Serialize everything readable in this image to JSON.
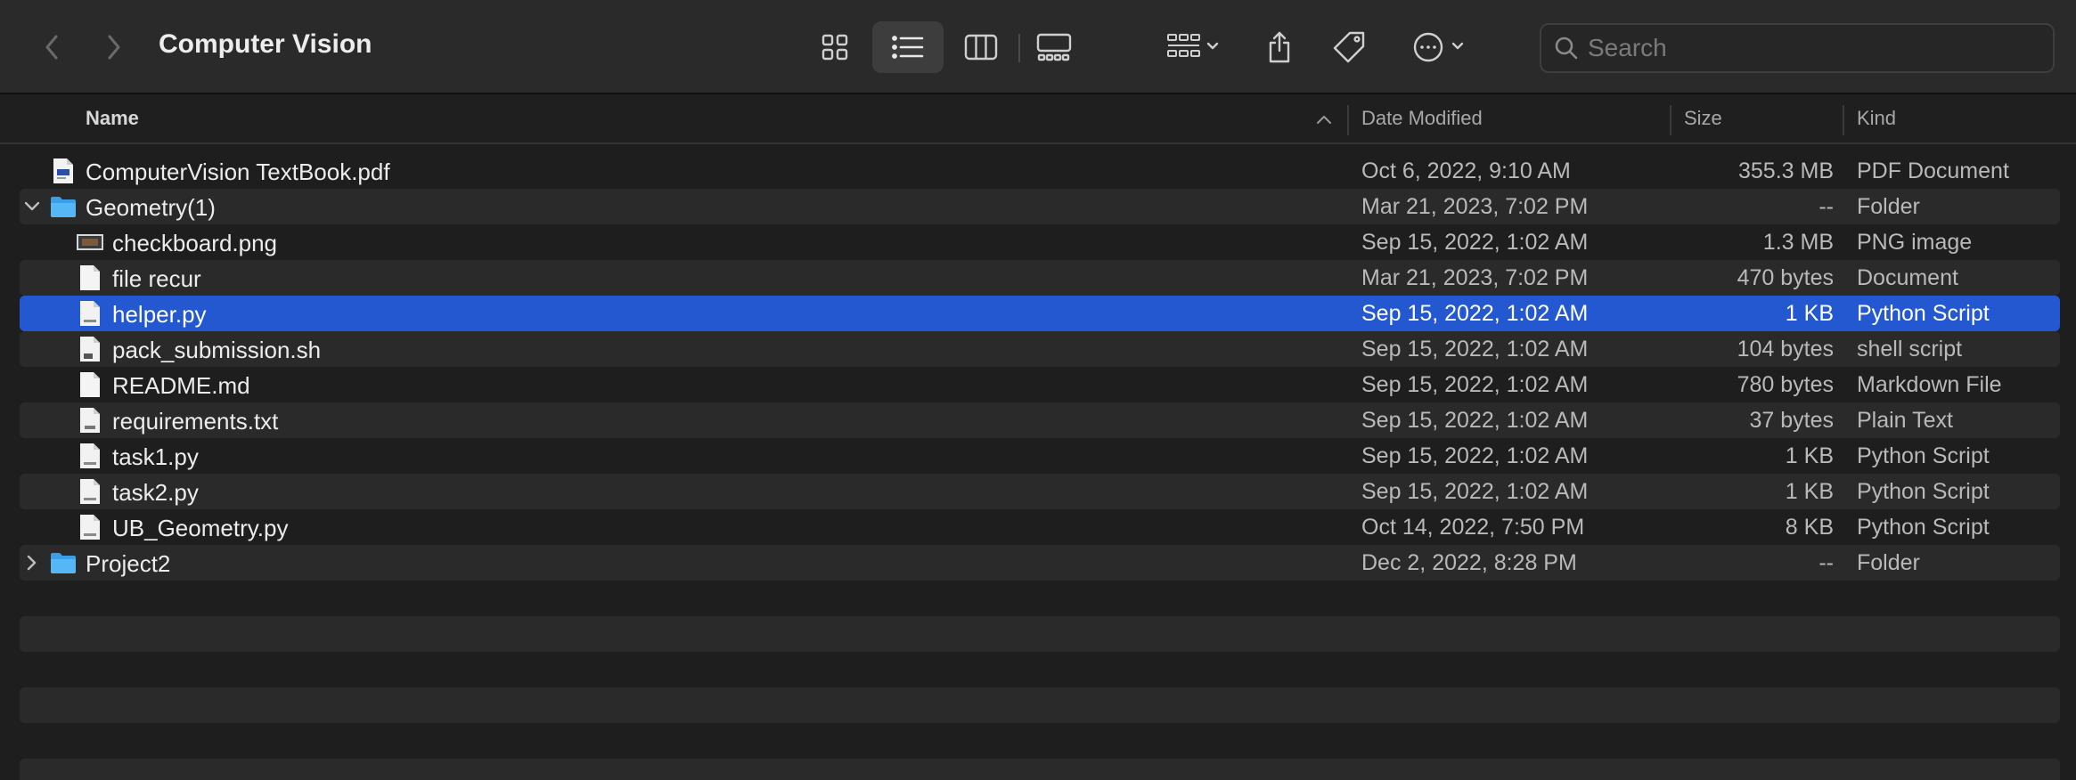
{
  "window": {
    "title": "Computer Vision"
  },
  "toolbar": {
    "back_icon": "chevron-left-icon",
    "forward_icon": "chevron-right-icon",
    "views": [
      "icon-view-icon",
      "list-view-icon",
      "column-view-icon",
      "gallery-view-icon"
    ],
    "active_view": "list",
    "group_icon": "group-by-icon",
    "share_icon": "share-icon",
    "tag_icon": "tag-icon",
    "more_icon": "ellipsis-circle-icon"
  },
  "search": {
    "placeholder": "Search",
    "value": ""
  },
  "columns": {
    "name": "Name",
    "date": "Date Modified",
    "size": "Size",
    "kind": "Kind"
  },
  "sort": {
    "column": "name",
    "direction": "ascending"
  },
  "files": [
    {
      "name": "ComputerVision TextBook.pdf",
      "date": "Oct 6, 2022, 9:10 AM",
      "size": "355.3 MB",
      "kind": "PDF Document",
      "icon": "pdf-file-icon",
      "level": 0,
      "disclosure": ""
    },
    {
      "name": "Geometry(1)",
      "date": "Mar 21, 2023, 7:02 PM",
      "size": "--",
      "kind": "Folder",
      "icon": "folder-icon",
      "level": 0,
      "disclosure": "expanded"
    },
    {
      "name": "checkboard.png",
      "date": "Sep 15, 2022, 1:02 AM",
      "size": "1.3 MB",
      "kind": "PNG image",
      "icon": "image-file-icon",
      "level": 1,
      "disclosure": ""
    },
    {
      "name": "file recur",
      "date": "Mar 21, 2023, 7:02 PM",
      "size": "470 bytes",
      "kind": "Document",
      "icon": "document-icon",
      "level": 1,
      "disclosure": ""
    },
    {
      "name": "helper.py",
      "date": "Sep 15, 2022, 1:02 AM",
      "size": "1 KB",
      "kind": "Python Script",
      "icon": "python-file-icon",
      "level": 1,
      "disclosure": "",
      "selected": true
    },
    {
      "name": "pack_submission.sh",
      "date": "Sep 15, 2022, 1:02 AM",
      "size": "104 bytes",
      "kind": "shell script",
      "icon": "shell-script-icon",
      "level": 1,
      "disclosure": ""
    },
    {
      "name": "README.md",
      "date": "Sep 15, 2022, 1:02 AM",
      "size": "780 bytes",
      "kind": "Markdown File",
      "icon": "document-icon",
      "level": 1,
      "disclosure": ""
    },
    {
      "name": "requirements.txt",
      "date": "Sep 15, 2022, 1:02 AM",
      "size": "37 bytes",
      "kind": "Plain Text",
      "icon": "text-file-icon",
      "level": 1,
      "disclosure": ""
    },
    {
      "name": "task1.py",
      "date": "Sep 15, 2022, 1:02 AM",
      "size": "1 KB",
      "kind": "Python Script",
      "icon": "python-file-icon",
      "level": 1,
      "disclosure": ""
    },
    {
      "name": "task2.py",
      "date": "Sep 15, 2022, 1:02 AM",
      "size": "1 KB",
      "kind": "Python Script",
      "icon": "python-file-icon",
      "level": 1,
      "disclosure": ""
    },
    {
      "name": "UB_Geometry.py",
      "date": "Oct 14, 2022, 7:50 PM",
      "size": "8 KB",
      "kind": "Python Script",
      "icon": "python-file-icon",
      "level": 1,
      "disclosure": ""
    },
    {
      "name": "Project2",
      "date": "Dec 2, 2022, 8:28 PM",
      "size": "--",
      "kind": "Folder",
      "icon": "folder-icon",
      "level": 0,
      "disclosure": "collapsed"
    }
  ],
  "colors": {
    "selection": "#2358d1",
    "folder": "#3fa9f5",
    "background": "#1e1e1e",
    "stripe": "#2a2a2a"
  }
}
